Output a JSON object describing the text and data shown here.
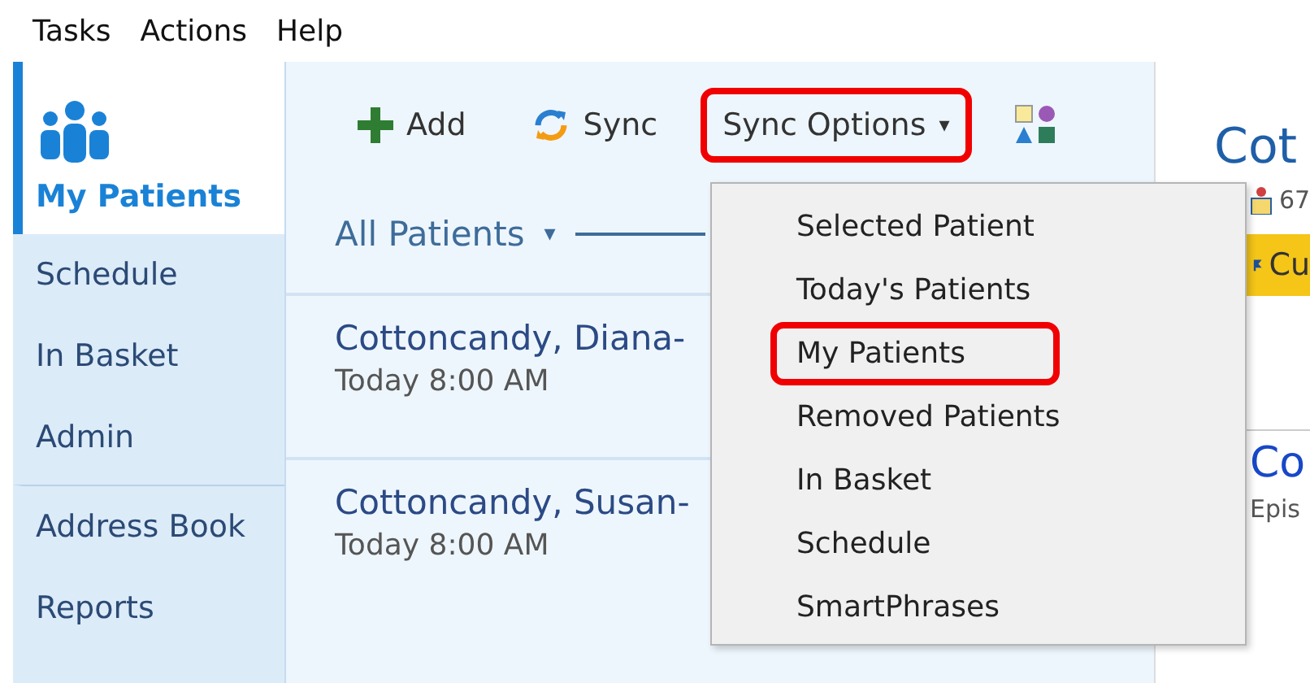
{
  "menu_bar": [
    "Tasks",
    "Actions",
    "Help"
  ],
  "sidebar": {
    "items": [
      {
        "label": "My Patients",
        "selected": true,
        "divider_before": false
      },
      {
        "label": "Schedule",
        "selected": false,
        "divider_before": false
      },
      {
        "label": "In Basket",
        "selected": false,
        "divider_before": false
      },
      {
        "label": "Admin",
        "selected": false,
        "divider_before": false
      },
      {
        "label": "Address Book",
        "selected": false,
        "divider_before": true
      },
      {
        "label": "Reports",
        "selected": false,
        "divider_before": false
      }
    ]
  },
  "toolbar": [
    {
      "kind": "add",
      "label": "Add",
      "highlighted": false
    },
    {
      "kind": "sync",
      "label": "Sync",
      "highlighted": false
    },
    {
      "kind": "dropdown",
      "label": "Sync Options",
      "caret": "▾",
      "highlighted": true
    },
    {
      "kind": "shapes",
      "highlighted": false
    }
  ],
  "list_filter": {
    "label": "All Patients",
    "caret": "▾"
  },
  "patients": [
    {
      "name": "Cottoncandy, Diana-",
      "time": "Today 8:00 AM"
    },
    {
      "name": "Cottoncandy, Susan-",
      "time": "Today 8:00 AM"
    }
  ],
  "sync_menu": {
    "items": [
      {
        "label": "Selected Patient",
        "highlighted": false
      },
      {
        "label": "Today's Patients",
        "highlighted": false
      },
      {
        "label": "My Patients",
        "highlighted": true
      },
      {
        "label": "Removed Patients",
        "highlighted": false
      },
      {
        "label": "In Basket",
        "highlighted": false
      },
      {
        "label": "Schedule",
        "highlighted": false
      },
      {
        "label": "SmartPhrases",
        "highlighted": false
      }
    ]
  },
  "detail": {
    "title": "Cot",
    "info": "67",
    "banner": "Cu",
    "card_title": "Co",
    "card_subtitle": "Epis"
  }
}
